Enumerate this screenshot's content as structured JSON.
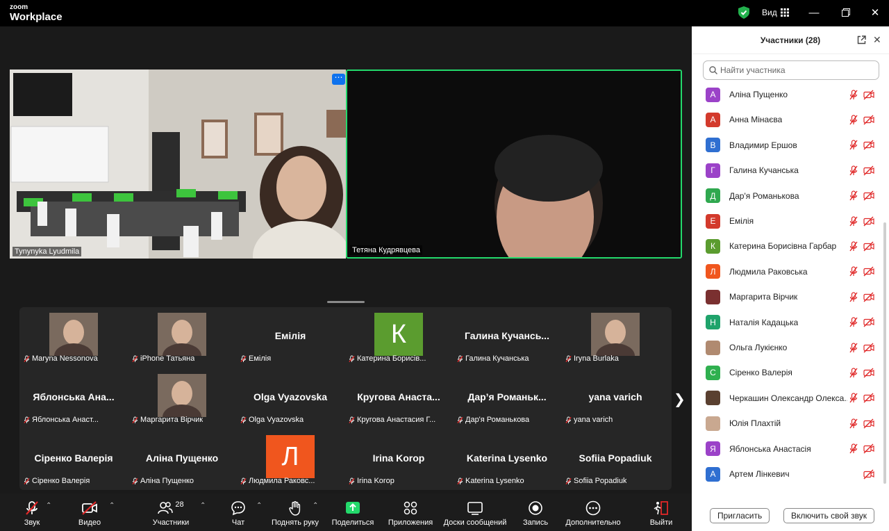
{
  "app": {
    "brand_small": "zoom",
    "brand_big": "Workplace",
    "view_label": "Вид"
  },
  "tiles": {
    "left_name": "Tynynyka Lyudmila",
    "right_name": "Тетяна Кудрявцева"
  },
  "gallery": [
    {
      "big": "",
      "label": "Maryna Nessonova",
      "type": "photo"
    },
    {
      "big": "",
      "label": "iPhone Татьяна",
      "type": "photo"
    },
    {
      "big": "Емілія",
      "label": "Емілія",
      "type": "text"
    },
    {
      "big": "К",
      "label": "Катерина Борисів...",
      "type": "letter",
      "color": "#5b9c2f"
    },
    {
      "big": "Галина  Кучансь...",
      "label": "Галина Кучанська",
      "type": "text"
    },
    {
      "big": "",
      "label": "Iryna Burlaka",
      "type": "photo"
    },
    {
      "big": "Яблонська  Ана...",
      "label": "Яблонська Анаст...",
      "type": "text"
    },
    {
      "big": "",
      "label": "Маргарита Вірчик",
      "type": "photo"
    },
    {
      "big": "Olga Vyazovska",
      "label": "Olga Vyazovska",
      "type": "text"
    },
    {
      "big": "Кругова  Анаста...",
      "label": "Кругова Анастасия Г...",
      "type": "text"
    },
    {
      "big": "Дар’я  Романьк...",
      "label": "Дар'я Романькова",
      "type": "text"
    },
    {
      "big": "yana varich",
      "label": "yana varich",
      "type": "text"
    },
    {
      "big": "Сіренко Валерія",
      "label": "Сіренко Валерія",
      "type": "text"
    },
    {
      "big": "Аліна Пущенко",
      "label": "Аліна Пущенко",
      "type": "text"
    },
    {
      "big": "Л",
      "label": "Людмила Раковс...",
      "type": "letter",
      "color": "#f0561e"
    },
    {
      "big": "Irina Korop",
      "label": "Irina Korop",
      "type": "text"
    },
    {
      "big": "Katerina Lysenko",
      "label": "Katerina Lysenko",
      "type": "text"
    },
    {
      "big": "Sofiia Popadiuk",
      "label": "Sofiia Popadiuk",
      "type": "text"
    }
  ],
  "toolbar": {
    "audio": "Звук",
    "video": "Видео",
    "participants": "Участники",
    "participants_count": "28",
    "chat": "Чат",
    "raise_hand": "Поднять руку",
    "share": "Поделиться",
    "apps": "Приложения",
    "whiteboards": "Доски сообщений",
    "record": "Запись",
    "more": "Дополнительно",
    "leave": "Выйти"
  },
  "panel": {
    "title": "Участники (28)",
    "search_placeholder": "Найти участника",
    "invite": "Пригласить",
    "mute_me": "Включить свой звук",
    "participants": [
      {
        "initial": "А",
        "name": "Аліна Пущенко",
        "color": "#9b42c8",
        "mic": true
      },
      {
        "initial": "А",
        "name": "Анна Мінаєва",
        "color": "#d33a2c",
        "mic": true
      },
      {
        "initial": "В",
        "name": "Владимир Ершов",
        "color": "#2f6fd1",
        "mic": true
      },
      {
        "initial": "Г",
        "name": "Галина Кучанська",
        "color": "#9b42c8",
        "mic": true
      },
      {
        "initial": "Д",
        "name": "Дар'я Романькова",
        "color": "#2fa84f",
        "mic": true
      },
      {
        "initial": "Е",
        "name": "Емілія",
        "color": "#d33a2c",
        "mic": true
      },
      {
        "initial": "К",
        "name": "Катерина Борисівна Гарбар",
        "color": "#5b9c2f",
        "mic": true
      },
      {
        "initial": "Л",
        "name": "Людмила Раковська",
        "color": "#f0561e",
        "mic": true
      },
      {
        "initial": "",
        "name": "Маргарита Вірчик",
        "color": "#7a3030",
        "mic": true
      },
      {
        "initial": "Н",
        "name": "Наталія Кадацька",
        "color": "#1fa36b",
        "mic": true
      },
      {
        "initial": "",
        "name": "Ольга Лукієнко",
        "color": "#b08a70",
        "mic": true
      },
      {
        "initial": "С",
        "name": "Сіренко Валерія",
        "color": "#2fb04f",
        "mic": true
      },
      {
        "initial": "",
        "name": "Черкашин Олександр Олекса...",
        "color": "#5a4030",
        "mic": true
      },
      {
        "initial": "",
        "name": "Юлія Плахтій",
        "color": "#c9a890",
        "mic": true
      },
      {
        "initial": "Я",
        "name": "Яблонська Анастасія",
        "color": "#9b42c8",
        "mic": true
      },
      {
        "initial": "А",
        "name": "Артем Лінкевич",
        "color": "#2f6fd1",
        "mic": false
      }
    ]
  },
  "colors": {
    "accent": "#0e72ed",
    "active_speaker": "#23d96b",
    "mute_red": "#e02828",
    "share_green": "#23d96b"
  }
}
